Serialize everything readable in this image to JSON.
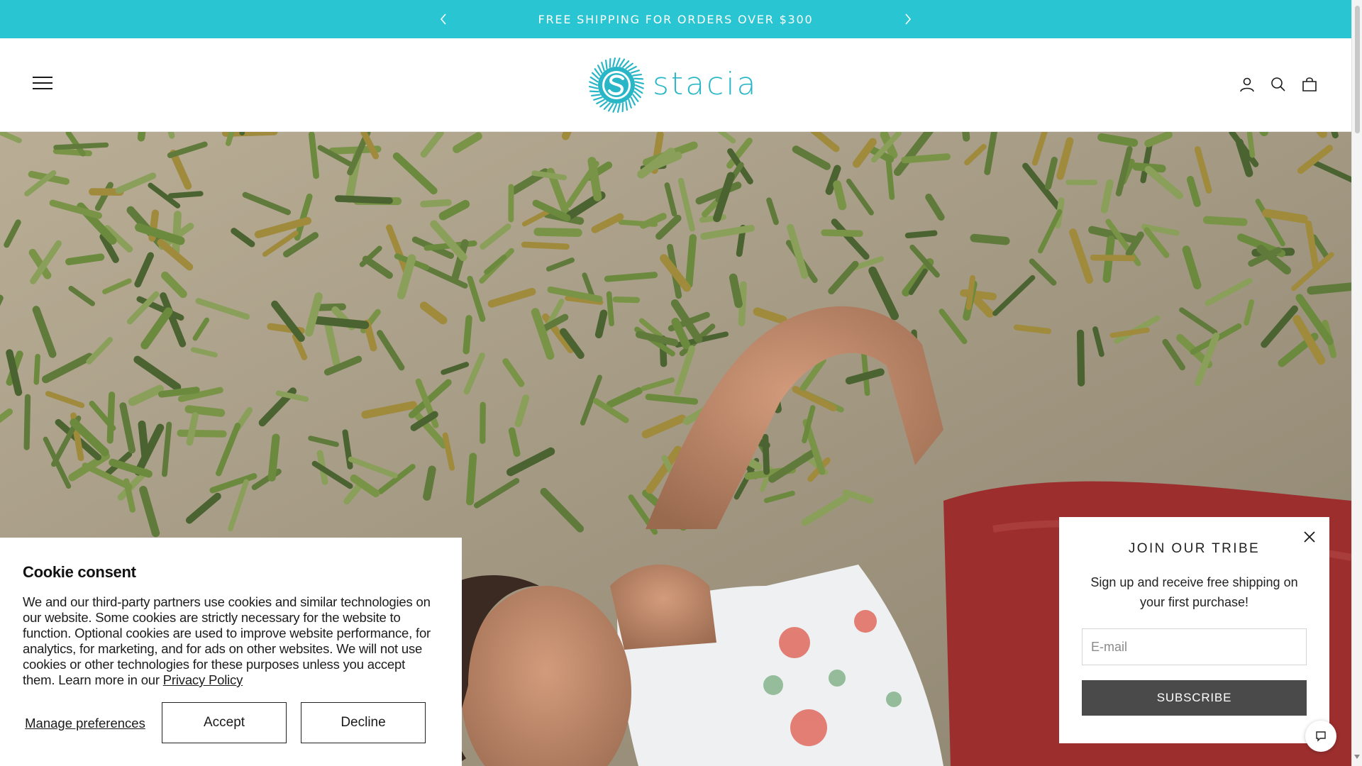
{
  "announcement": {
    "message": "FREE SHIPPING FOR ORDERS OVER $300",
    "prev_icon": "chevron-left-icon",
    "next_icon": "chevron-right-icon"
  },
  "header": {
    "menu_icon": "hamburger-menu-icon",
    "logo_text": "stacia",
    "icons": [
      "account-icon",
      "search-icon",
      "cart-bag-icon"
    ]
  },
  "hero": {
    "image": "woman lying on sand among succulents"
  },
  "cookie": {
    "title": "Cookie consent",
    "body": "We and our third-party partners use cookies and similar technologies on our website. Some cookies are strictly necessary for the website to function. Optional cookies are used to improve website performance, for analytics, for marketing, and for ads on other websites. We will not use cookies or other technologies for these purposes unless you accept them. Learn more in our ",
    "policy_link": "Privacy Policy",
    "manage_label": "Manage preferences",
    "accept_label": "Accept",
    "decline_label": "Decline"
  },
  "newsletter": {
    "title": "JOIN OUR TRIBE",
    "subtitle": "Sign up and receive free shipping on your first purchase!",
    "email_placeholder": "E-mail",
    "email_value": "",
    "subscribe_label": "SUBSCRIBE",
    "close_icon": "close-icon"
  },
  "chat": {
    "icon": "chat-bubble-icon"
  },
  "colors": {
    "accent": "#29c5d3",
    "logo": "#29b6c6",
    "subscribe_bg": "#4a4a4a"
  }
}
